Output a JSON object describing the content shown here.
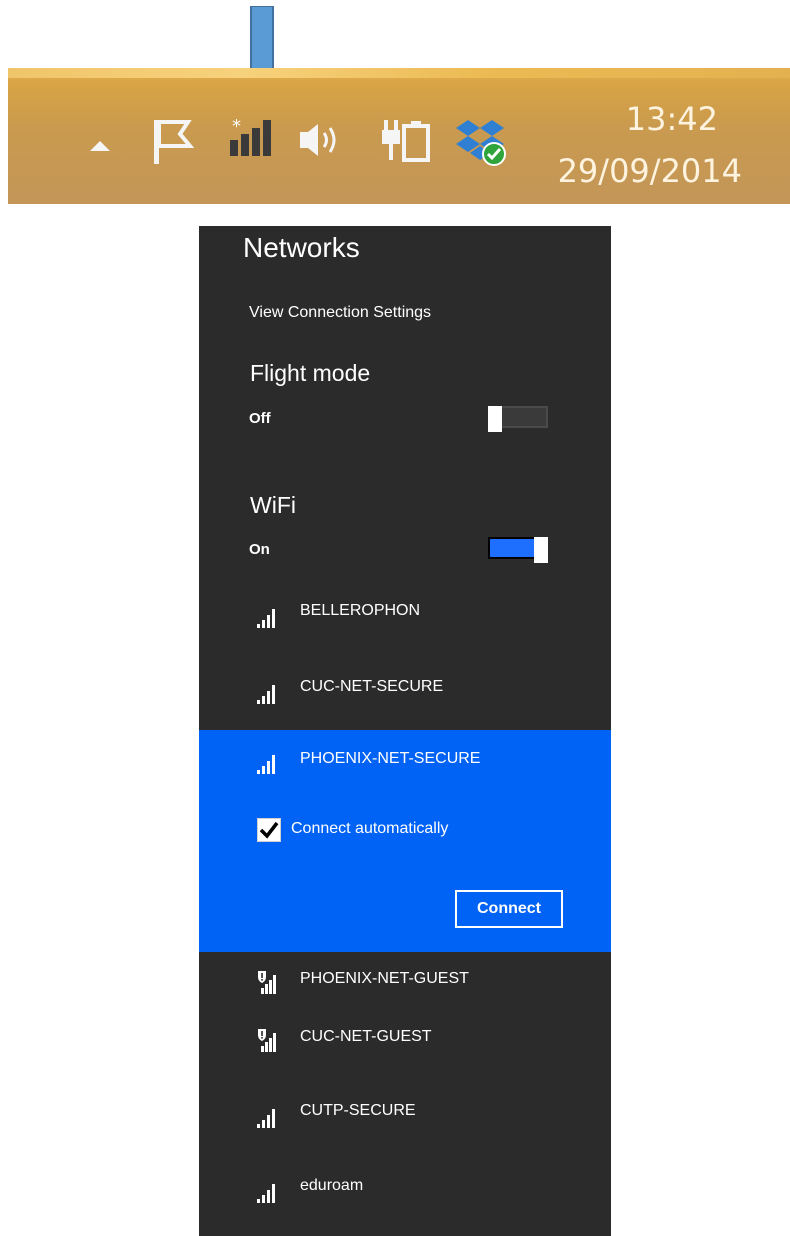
{
  "taskbar": {
    "clock": {
      "time": "13:42",
      "date": "29/09/2014"
    },
    "icons": [
      "show-hidden-icons-icon",
      "action-center-flag-icon",
      "network-no-connection-icon",
      "volume-icon",
      "power-plugged-battery-icon",
      "dropbox-synced-icon"
    ]
  },
  "pointer": {
    "color": "#5b9bd5",
    "icon": "down-arrow-icon"
  },
  "networks_panel": {
    "title": "Networks",
    "view_settings": "View Connection Settings",
    "flight_mode": {
      "label": "Flight mode",
      "state_text": "Off",
      "on": false
    },
    "wifi": {
      "label": "WiFi",
      "state_text": "On",
      "on": true
    },
    "networks": [
      {
        "name": "BELLEROPHON",
        "secured": true
      },
      {
        "name": "CUC-NET-SECURE",
        "secured": true
      },
      {
        "name": "PHOENIX-NET-SECURE",
        "secured": true,
        "selected": true
      },
      {
        "name": "PHOENIX-NET-GUEST",
        "secured": false
      },
      {
        "name": "CUC-NET-GUEST",
        "secured": false
      },
      {
        "name": "CUTP-SECURE",
        "secured": true
      },
      {
        "name": "eduroam",
        "secured": true
      }
    ],
    "selected_network": {
      "name": "PHOENIX-NET-SECURE",
      "connect_automatically": {
        "label": "Connect automatically",
        "checked": true
      },
      "connect_button": "Connect"
    }
  },
  "colors": {
    "panel_bg": "#2b2b2b",
    "accent": "#0063f5",
    "toggle_on": "#1f6fff"
  }
}
